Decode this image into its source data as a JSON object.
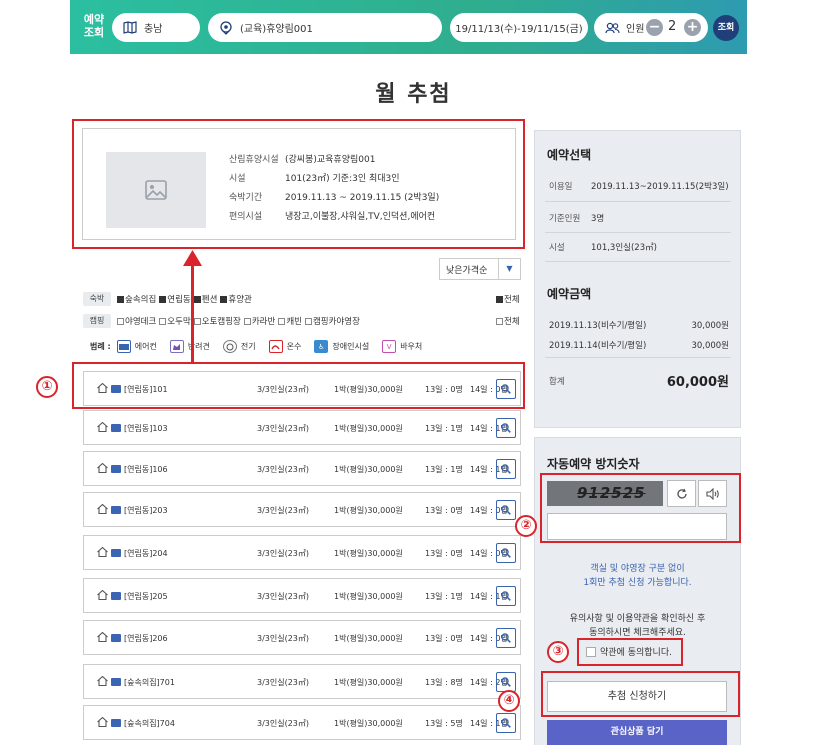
{
  "topbar": {
    "label": "예약 조회",
    "region": "충남",
    "facility": "(교육)휴양림001",
    "dates": "19/11/13(수)-19/11/15(금)",
    "people_label": "인원",
    "people_count": "2",
    "minus": "−",
    "plus": "+",
    "search": "조회"
  },
  "page_title": "월 추첨",
  "info": {
    "rows": [
      {
        "k": "산림휴양시설",
        "v": "(강씨봉)교육휴양림001"
      },
      {
        "k": "시설",
        "v": "101(23㎡) 기준:3인 최대3인"
      },
      {
        "k": "숙박기간",
        "v": "2019.11.13 ~ 2019.11.15 (2박3일)"
      },
      {
        "k": "편의시설",
        "v": "냉장고,이불장,샤워실,TV,인덕션,에어컨"
      }
    ]
  },
  "sort": {
    "selected": "낮은가격순",
    "arrow": "▼"
  },
  "filters": {
    "stay_tag": "숙박",
    "stay_items": [
      "숲속의집",
      "연립동",
      "펜션",
      "휴양관"
    ],
    "stay_all": "전체",
    "camp_tag": "캠핑",
    "camp_items": [
      "야영데크",
      "오두막",
      "오토캠핑장",
      "카라반",
      "캐빈",
      "캠핑카야영장"
    ],
    "camp_all": "전체"
  },
  "legend": {
    "title": "범례 :",
    "items": [
      "에어컨",
      "반려견",
      "전기",
      "온수",
      "장애인시설",
      "바우처"
    ],
    "v": "V"
  },
  "rooms": [
    {
      "name": "[연립동]101",
      "size": "3/3인실(23㎡)",
      "price": "1박(평일)30,000원",
      "d1": "13일 : 0명",
      "d2": "14일 : 0명"
    },
    {
      "name": "[연립동]103",
      "size": "3/3인실(23㎡)",
      "price": "1박(평일)30,000원",
      "d1": "13일 : 1명",
      "d2": "14일 : 1명"
    },
    {
      "name": "[연립동]106",
      "size": "3/3인실(23㎡)",
      "price": "1박(평일)30,000원",
      "d1": "13일 : 1명",
      "d2": "14일 : 1명"
    },
    {
      "name": "[연립동]203",
      "size": "3/3인실(23㎡)",
      "price": "1박(평일)30,000원",
      "d1": "13일 : 0명",
      "d2": "14일 : 0명"
    },
    {
      "name": "[연립동]204",
      "size": "3/3인실(23㎡)",
      "price": "1박(평일)30,000원",
      "d1": "13일 : 0명",
      "d2": "14일 : 0명"
    },
    {
      "name": "[연립동]205",
      "size": "3/3인실(23㎡)",
      "price": "1박(평일)30,000원",
      "d1": "13일 : 1명",
      "d2": "14일 : 1명"
    },
    {
      "name": "[연립동]206",
      "size": "3/3인실(23㎡)",
      "price": "1박(평일)30,000원",
      "d1": "13일 : 0명",
      "d2": "14일 : 0명"
    },
    {
      "name": "[숲속의집]701",
      "size": "3/3인실(23㎡)",
      "price": "1박(평일)30,000원",
      "d1": "13일 : 8명",
      "d2": "14일 : 2명"
    },
    {
      "name": "[숲속의집]704",
      "size": "3/3인실(23㎡)",
      "price": "1박(평일)30,000원",
      "d1": "13일 : 5명",
      "d2": "14일 : 1명"
    }
  ],
  "selection": {
    "title": "예약선택",
    "rows": [
      {
        "k": "이용일",
        "v": "2019.11.13~2019.11.15(2박3일)"
      },
      {
        "k": "기준인원",
        "v": "3명"
      },
      {
        "k": "시설",
        "v": "101,3인실(23㎡)"
      }
    ]
  },
  "amount": {
    "title": "예약금액",
    "rows": [
      {
        "k": "2019.11.13(비수기/평일)",
        "v": "30,000원"
      },
      {
        "k": "2019.11.14(비수기/평일)",
        "v": "30,000원"
      }
    ],
    "total_label": "합계",
    "total": "60,000원"
  },
  "captcha": {
    "title": "자동예약 방지숫자",
    "code": "912525",
    "note": [
      "객실 및 야영장 구분 없이",
      "1회만 추첨 신청 가능합니다."
    ],
    "notice": [
      "유의사항 및 이용약관을 확인하신 후",
      "동의하시면 체크해주세요."
    ],
    "agree": "약관에 동의합니다."
  },
  "buttons": {
    "apply": "추첨 신청하기",
    "interest": "관심상품 담기"
  },
  "markers": [
    "①",
    "②",
    "③",
    "④"
  ],
  "colors": {
    "accent": "#d9242b",
    "brand_green": "#2bbfa0",
    "navy": "#1e3f7a",
    "blue": "#3a63b0",
    "purple": "#5a63c8"
  }
}
